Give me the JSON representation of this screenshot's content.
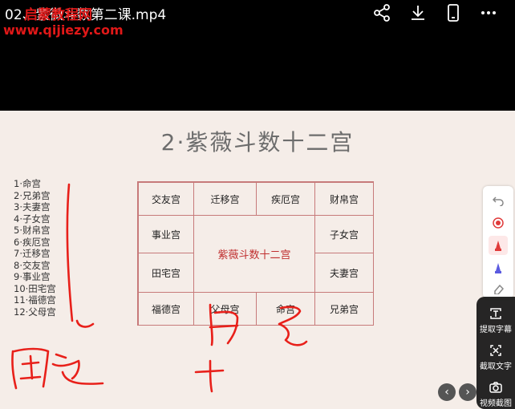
{
  "player": {
    "file_title": "02、紫微斗数第二课.mp4",
    "watermark_name": "启蒙教程网",
    "watermark_url": "www.qijiezy.com"
  },
  "toolbar_icons": [
    "share-icon",
    "download-icon",
    "phone-icon",
    "more-icon"
  ],
  "slide": {
    "title": "2·紫薇斗数十二宫",
    "list": [
      "1·命宫",
      "2·兄弟宫",
      "3·夫妻宫",
      "4·子女宫",
      "5·财帛宫",
      "6·疾厄宫",
      "7·迁移宫",
      "8·交友宫",
      "9·事业宫",
      "10·田宅宫",
      "11·福德宫",
      "12·父母宫"
    ],
    "grid": {
      "top": [
        "交友宫",
        "迁移宫",
        "疾厄宫",
        "财帛宫"
      ],
      "left": [
        "事业宫",
        "田宅宫"
      ],
      "right": [
        "子女宫",
        "夫妻宫"
      ],
      "bottom": [
        "福德宫",
        "父母宫",
        "命宫",
        "兄弟宫"
      ],
      "center": "紫薇斗数十二宫"
    }
  },
  "side_panel": {
    "items": [
      {
        "label": "提取字幕",
        "icon": "text-extract-icon"
      },
      {
        "label": "截取文字",
        "icon": "crop-text-icon"
      },
      {
        "label": "视频截图",
        "icon": "camera-icon"
      }
    ]
  },
  "colors": {
    "accent": "#e01818",
    "grid_line": "#c77a7a",
    "slide_bg": "#f5ede8"
  }
}
